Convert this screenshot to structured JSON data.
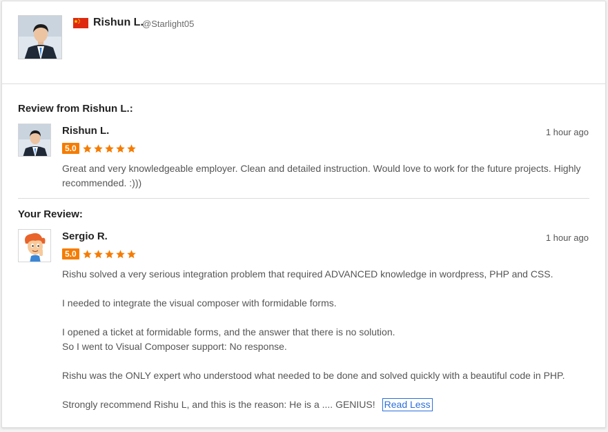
{
  "header": {
    "name": "Rishun L.",
    "handle": "@Starlight05",
    "flag_icon": "china-flag-icon"
  },
  "review_from": {
    "section_title": "Review from Rishun L.:",
    "reviewer": "Rishun L.",
    "time": "1 hour ago",
    "rating": "5.0",
    "star_count": 5,
    "text": "Great and very knowledgeable employer. Clean and detailed instruction. Would love to work for the future projects. Highly recommended. :)))"
  },
  "your_review": {
    "section_title": "Your Review:",
    "reviewer": "Sergio R.",
    "time": "1 hour ago",
    "rating": "5.0",
    "star_count": 5,
    "paragraphs": [
      "Rishu solved a very serious integration problem that required ADVANCED knowledge in wordpress, PHP and CSS.",
      "I needed to integrate the visual composer with formidable forms.",
      "I opened a ticket at formidable forms, and the answer that there is no solution.",
      "So I went to Visual Composer support: No response.",
      "Rishu was the ONLY expert who understood what needed to be done and solved quickly with a beautiful code in PHP.",
      "Strongly recommend Rishu L, and this is the reason: He is a .... GENIUS!"
    ],
    "read_less_label": "Read Less"
  },
  "colors": {
    "accent": "#f57c00",
    "link": "#2a6fdb"
  }
}
